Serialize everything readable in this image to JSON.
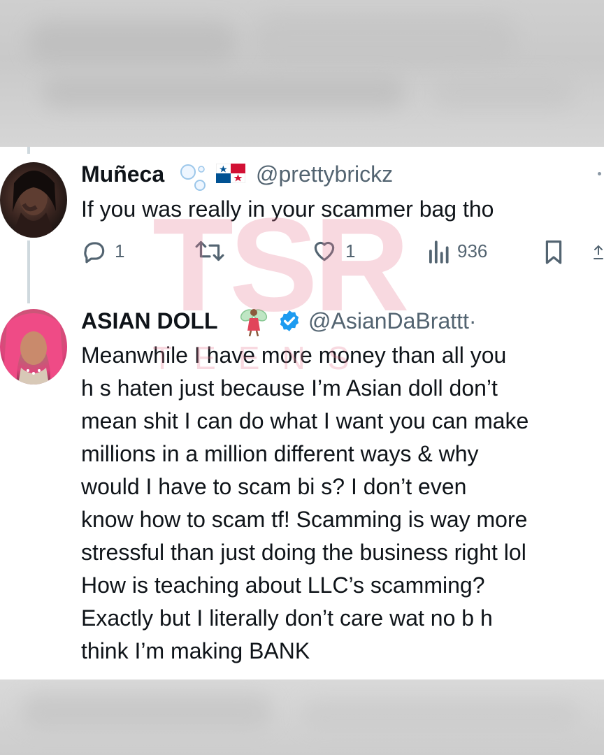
{
  "tweets": [
    {
      "display_name": "Muñeca",
      "handle": "@prettybrickz",
      "text": "If you was really in your scammer bag tho",
      "stats": {
        "replies": "1",
        "likes": "1",
        "views": "936"
      }
    },
    {
      "display_name": "ASIAN DOLL",
      "handle": "@AsianDaBrattt",
      "handle_suffix": "·",
      "verified": true,
      "text_lines": [
        "Meanwhile I have more money than all you",
        "h    s haten just because I’m Asian doll don’t",
        "mean shit I can do what I want you can make",
        "millions in a million different ways & why",
        "would I have to scam bi      s?  I don’t even",
        "know how to scam tf! Scamming is way more",
        "stressful than just doing the business right lol",
        "How is teaching about LLC’s scamming?",
        "Exactly but I literally don’t care wat no b    h",
        "think I’m making BANK"
      ]
    }
  ],
  "watermark": {
    "logo": "TSR",
    "sub": "TEENS"
  },
  "colors": {
    "text": "#0f1419",
    "secondary": "#536471",
    "verified": "#1d9bf0",
    "watermark": "#e97a93"
  },
  "icons": [
    "reply-icon",
    "retweet-icon",
    "like-icon",
    "views-icon",
    "bookmark-icon",
    "share-icon",
    "verified-badge-icon",
    "panama-flag-icon",
    "bubbles-emoji-icon",
    "fairy-emoji-icon"
  ]
}
